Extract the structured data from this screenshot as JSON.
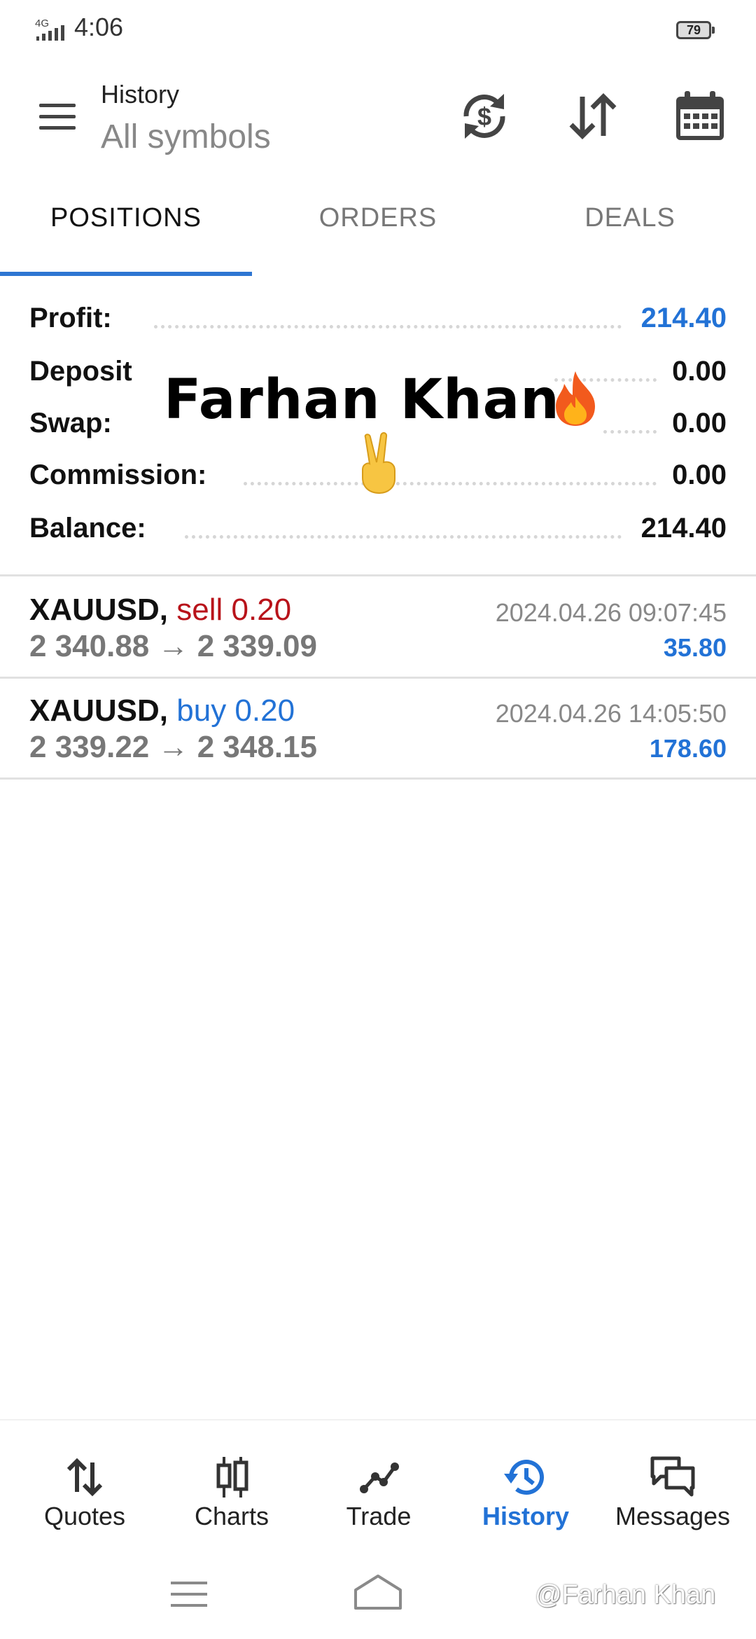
{
  "status_bar": {
    "network": "4G",
    "time": "4:06",
    "battery": "79"
  },
  "header": {
    "title": "History",
    "subtitle": "All symbols"
  },
  "tabs": [
    {
      "label": "POSITIONS",
      "active": true
    },
    {
      "label": "ORDERS",
      "active": false
    },
    {
      "label": "DEALS",
      "active": false
    }
  ],
  "summary": {
    "profit_label": "Profit:",
    "profit_value": "214.40",
    "deposit_label": "Deposit",
    "deposit_value": "0.00",
    "swap_label": "Swap:",
    "swap_value": "0.00",
    "commission_label": "Commission:",
    "commission_value": "0.00",
    "balance_label": "Balance:",
    "balance_value": "214.40"
  },
  "overlay": {
    "name": "Farhan Khan"
  },
  "positions": [
    {
      "symbol": "XAUUSD,",
      "side": "sell 0.20",
      "prices": "2 340.88 → 2 339.09",
      "time": "2024.04.26 09:07:45",
      "profit": "35.80"
    },
    {
      "symbol": "XAUUSD,",
      "side": "buy 0.20",
      "prices": "2 339.22 → 2 348.15",
      "time": "2024.04.26 14:05:50",
      "profit": "178.60"
    }
  ],
  "bottom_nav": [
    {
      "label": "Quotes",
      "icon": "quotes-icon"
    },
    {
      "label": "Charts",
      "icon": "charts-icon"
    },
    {
      "label": "Trade",
      "icon": "trade-icon"
    },
    {
      "label": "History",
      "icon": "history-icon",
      "active": true
    },
    {
      "label": "Messages",
      "icon": "messages-icon"
    }
  ],
  "credit": "@Farhan Khan",
  "colors": {
    "accent": "#2272d6",
    "sell": "#b8131a",
    "text": "#111111",
    "muted": "#777777"
  }
}
